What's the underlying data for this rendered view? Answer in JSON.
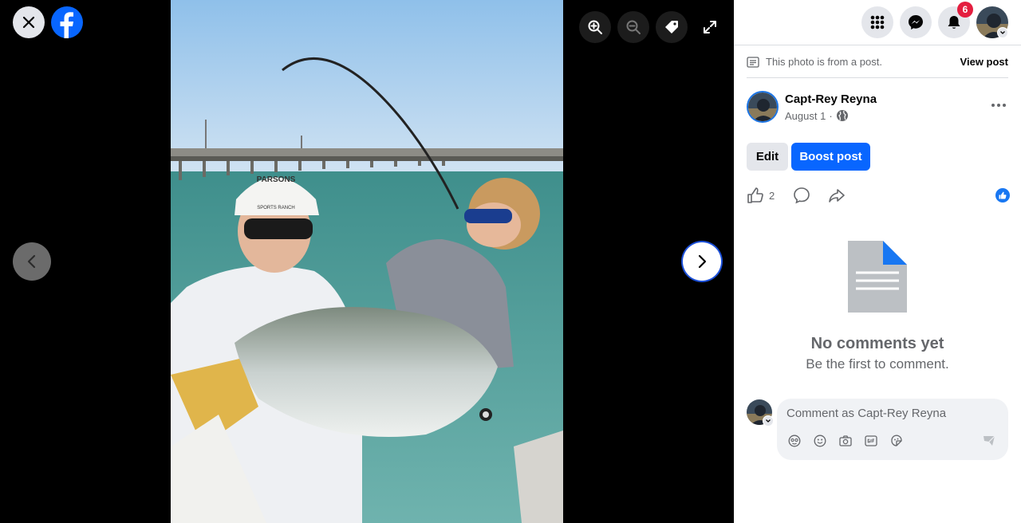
{
  "viewer": {
    "close_icon": "close-icon",
    "logo": "facebook-logo",
    "tools": [
      "zoom-in-icon",
      "zoom-out-icon",
      "tag-icon",
      "expand-icon"
    ],
    "nav": [
      "chevron-left-icon",
      "chevron-right-icon"
    ],
    "photo_cap_text": "PARSONS",
    "photo_cap_subtext": "SPORTS RANCH"
  },
  "topbar": {
    "icons": [
      "menu-grid-icon",
      "messenger-icon",
      "bell-icon"
    ],
    "notification_count": "6"
  },
  "post": {
    "source_text": "This photo is from a post.",
    "view_post_label": "View post",
    "author_name": "Capt-Rey Reyna",
    "date": "August 1",
    "separator": "·",
    "privacy_icon": "globe-icon",
    "edit_label": "Edit",
    "boost_label": "Boost post",
    "like_count": "2"
  },
  "comments": {
    "empty_title": "No comments yet",
    "empty_subtitle": "Be the first to comment.",
    "placeholder": "Comment as Capt-Rey Reyna"
  },
  "colors": {
    "accent": "#0866ff",
    "notification": "#e41e3f",
    "panel_bg": "#ffffff",
    "viewer_bg": "#000000"
  }
}
